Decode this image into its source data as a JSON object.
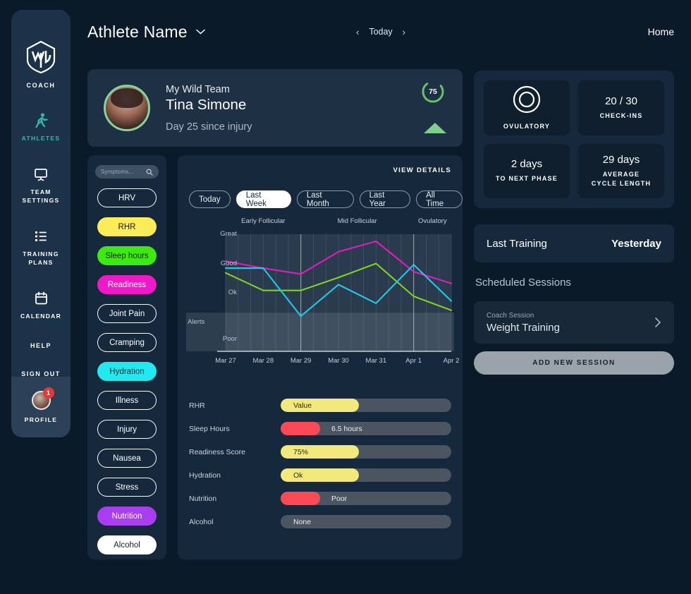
{
  "brand": {
    "label": "COACH",
    "logo_icon": "wild-logo-icon"
  },
  "sidebar": {
    "items": [
      {
        "label": "ATHLETES",
        "icon": "running-person-icon",
        "active": true
      },
      {
        "label": "TEAM\nSETTINGS",
        "icon": "presentation-board-icon",
        "active": false
      },
      {
        "label": "TRAINING\nPLANS",
        "icon": "list-checklist-icon",
        "active": false
      },
      {
        "label": "CALENDAR",
        "icon": "calendar-icon",
        "active": false
      }
    ],
    "help_label": "HELP",
    "signout_label": "SIGN OUT",
    "profile": {
      "label": "PROFILE",
      "badge_count": "1",
      "avatar_icon": "user-avatar-icon"
    }
  },
  "header": {
    "athlete_selector": "Athlete Name",
    "chevron_icon": "chevron-down-icon",
    "prev_icon": "chevron-left-icon",
    "next_icon": "chevron-right-icon",
    "date_label": "Today",
    "home_link": "Home"
  },
  "athlete_card": {
    "team": "My Wild Team",
    "name": "Tina Simone",
    "status": "Day 25 since injury",
    "score": "75",
    "score_ring_color": "#6abf69",
    "trend_icon": "triangle-up-icon",
    "trend_color": "#7fce8c",
    "avatar_icon": "athlete-photo-icon"
  },
  "symptoms": {
    "search_placeholder": "Symptoms...",
    "search_icon": "search-icon",
    "chips": [
      {
        "label": "HRV",
        "style": "outline",
        "bg": "",
        "fg": "#ffffff"
      },
      {
        "label": "RHR",
        "style": "filled",
        "bg": "#fdec5a",
        "fg": "#1a1a1a"
      },
      {
        "label": "Sleep hours",
        "style": "filled",
        "bg": "#3ee811",
        "fg": "#0e2a06"
      },
      {
        "label": "Readiness",
        "style": "filled",
        "bg": "#f019c8",
        "fg": "#ffffff"
      },
      {
        "label": "Joint Pain",
        "style": "outline",
        "bg": "",
        "fg": "#ffffff"
      },
      {
        "label": "Cramping",
        "style": "outline",
        "bg": "",
        "fg": "#ffffff"
      },
      {
        "label": "Hydration",
        "style": "filled",
        "bg": "#22e8f0",
        "fg": "#07333a"
      },
      {
        "label": "Illness",
        "style": "outline",
        "bg": "",
        "fg": "#ffffff"
      },
      {
        "label": "Injury",
        "style": "outline",
        "bg": "",
        "fg": "#ffffff"
      },
      {
        "label": "Nausea",
        "style": "outline",
        "bg": "",
        "fg": "#ffffff"
      },
      {
        "label": "Stress",
        "style": "outline",
        "bg": "",
        "fg": "#ffffff"
      },
      {
        "label": "Nutrition",
        "style": "filled",
        "bg": "#a93ef0",
        "fg": "#ffffff"
      },
      {
        "label": "Alcohol",
        "style": "filled",
        "bg": "#ffffff",
        "fg": "#15212c"
      }
    ]
  },
  "chart_panel": {
    "view_details_label": "VIEW DETAILS",
    "range_tabs": [
      {
        "label": "Today",
        "active": false
      },
      {
        "label": "Last Week",
        "active": true
      },
      {
        "label": "Last Month",
        "active": false
      },
      {
        "label": "Last Year",
        "active": false
      },
      {
        "label": "All Time",
        "active": false
      }
    ]
  },
  "chart_data": {
    "type": "line",
    "title": "",
    "xlabel": "",
    "ylabel": "",
    "grid": true,
    "legend": "none",
    "x": [
      "Mar 27",
      "Mar 28",
      "Mar 29",
      "Mar 30",
      "Mar 31",
      "Apr 1",
      "Apr 2"
    ],
    "y_tick_labels": [
      "Great",
      "Good",
      "Ok",
      "Alerts",
      "Poor"
    ],
    "y_tick_values": [
      100,
      75,
      50,
      25,
      10
    ],
    "ylim": [
      0,
      100
    ],
    "alert_band": {
      "label": "Alerts",
      "from": 0,
      "to": 33
    },
    "phases": [
      {
        "label": "Early Follicular",
        "start_index": 0,
        "end_index": 2
      },
      {
        "label": "Mid Follicular",
        "start_index": 2,
        "end_index": 5
      },
      {
        "label": "Ovulatory",
        "start_index": 5,
        "end_index": 6
      }
    ],
    "series": [
      {
        "name": "Readiness",
        "color": "#e11cc0",
        "values": [
          77,
          71,
          66,
          85,
          94,
          68,
          58
        ]
      },
      {
        "name": "Sleep hours",
        "color": "#7ed321",
        "values": [
          67,
          52,
          52,
          63,
          75,
          47,
          35
        ]
      },
      {
        "name": "Hydration",
        "color": "#22c8e8",
        "values": [
          71,
          71,
          30,
          57,
          41,
          74,
          43
        ]
      }
    ]
  },
  "metrics": [
    {
      "label": "RHR",
      "value": "Value",
      "fill_pct": 46,
      "fill_color": "#f2e87c",
      "value_color": "#2a2a20",
      "value_left": 18
    },
    {
      "label": "Sleep Hours",
      "value": "6.5 hours",
      "fill_pct": 23,
      "fill_color": "#fb4a55",
      "value_color": "#e8eef3",
      "value_left": 72
    },
    {
      "label": "Readiness Score",
      "value": "75%",
      "fill_pct": 46,
      "fill_color": "#f2e87c",
      "value_color": "#2a2a20",
      "value_left": 18
    },
    {
      "label": "Hydration",
      "value": "Ok",
      "fill_pct": 46,
      "fill_color": "#f2e87c",
      "value_color": "#2a2a20",
      "value_left": 18
    },
    {
      "label": "Nutrition",
      "value": "Poor",
      "fill_pct": 23,
      "fill_color": "#fb4a55",
      "value_color": "#e8eef3",
      "value_left": 72
    },
    {
      "label": "Alcohol",
      "value": "None",
      "fill_pct": 0,
      "fill_color": "#4b5561",
      "value_color": "#e8eef3",
      "value_left": 18
    }
  ],
  "stats": [
    {
      "value": "",
      "caption": "OVULATORY",
      "icon": "ovulatory-ring-icon"
    },
    {
      "value": "20 / 30",
      "caption": "CHECK-INS",
      "icon": ""
    },
    {
      "value": "2 days",
      "caption": "TO NEXT PHASE",
      "icon": ""
    },
    {
      "value": "29 days",
      "caption": "AVERAGE\nCYCLE LENGTH",
      "icon": ""
    }
  ],
  "training": {
    "last_training_label": "Last Training",
    "last_training_value": "Yesterday",
    "scheduled_title": "Scheduled Sessions",
    "session": {
      "subtitle": "Coach Session",
      "title": "Weight Training",
      "chevron_icon": "chevron-right-icon"
    },
    "add_session_label": "ADD NEW SESSION"
  }
}
